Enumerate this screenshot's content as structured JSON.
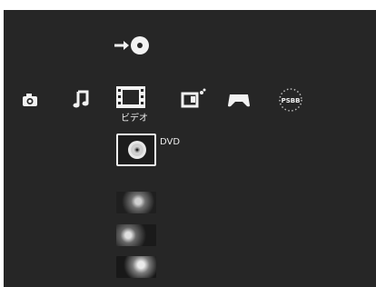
{
  "xmb": {
    "top_item_icon": "disc-insert-icon",
    "categories": [
      {
        "icon": "camera-icon"
      },
      {
        "icon": "music-note-icon"
      },
      {
        "icon": "film-strip-icon",
        "label": "ビデオ",
        "selected": true
      },
      {
        "icon": "tv-game-icon"
      },
      {
        "icon": "gamepad-icon"
      },
      {
        "icon": "psbb-icon",
        "text": "PSBB"
      }
    ],
    "selected_item": {
      "icon": "dvd-disc-icon",
      "label": "DVD"
    },
    "thumbnails_count_visible": 3
  },
  "colors": {
    "background": "#262626",
    "foreground": "#f2f2f2",
    "frame": "#ffffff"
  }
}
